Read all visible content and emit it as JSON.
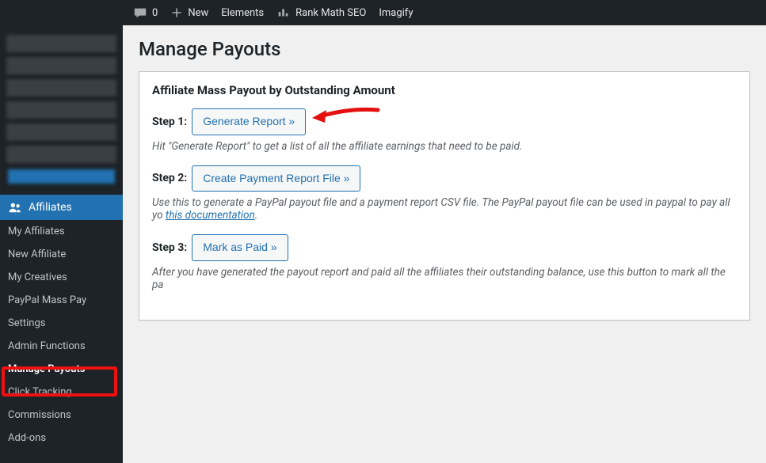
{
  "adminbar": {
    "comments_count": "0",
    "new_label": "New",
    "elements_label": "Elements",
    "rankmath_label": "Rank Math SEO",
    "imagify_label": "Imagify"
  },
  "sidebar": {
    "affiliates_label": "Affiliates",
    "submenu": [
      "My Affiliates",
      "New Affiliate",
      "My Creatives",
      "PayPal Mass Pay",
      "Settings",
      "Admin Functions",
      "Manage Payouts",
      "Click Tracking",
      "Commissions",
      "Add-ons"
    ],
    "current_index": 6
  },
  "page": {
    "title": "Manage Payouts",
    "panel_heading": "Affiliate Mass Payout by Outstanding Amount",
    "steps": {
      "s1_label": "Step 1:",
      "s1_button": "Generate Report »",
      "s1_hint": "Hit \"Generate Report\" to get a list of all the affiliate earnings that need to be paid.",
      "s2_label": "Step 2:",
      "s2_button": "Create Payment Report File »",
      "s2_hint_pre": "Use this to generate a PayPal payout file and a payment report CSV file. The PayPal payout file can be used in paypal to pay all yo",
      "s2_hint_link": "this documentation",
      "s2_hint_post": ".",
      "s3_label": "Step 3:",
      "s3_button": "Mark as Paid »",
      "s3_hint": "After you have generated the payout report and paid all the affiliates their outstanding balance, use this button to mark all the pa"
    }
  }
}
